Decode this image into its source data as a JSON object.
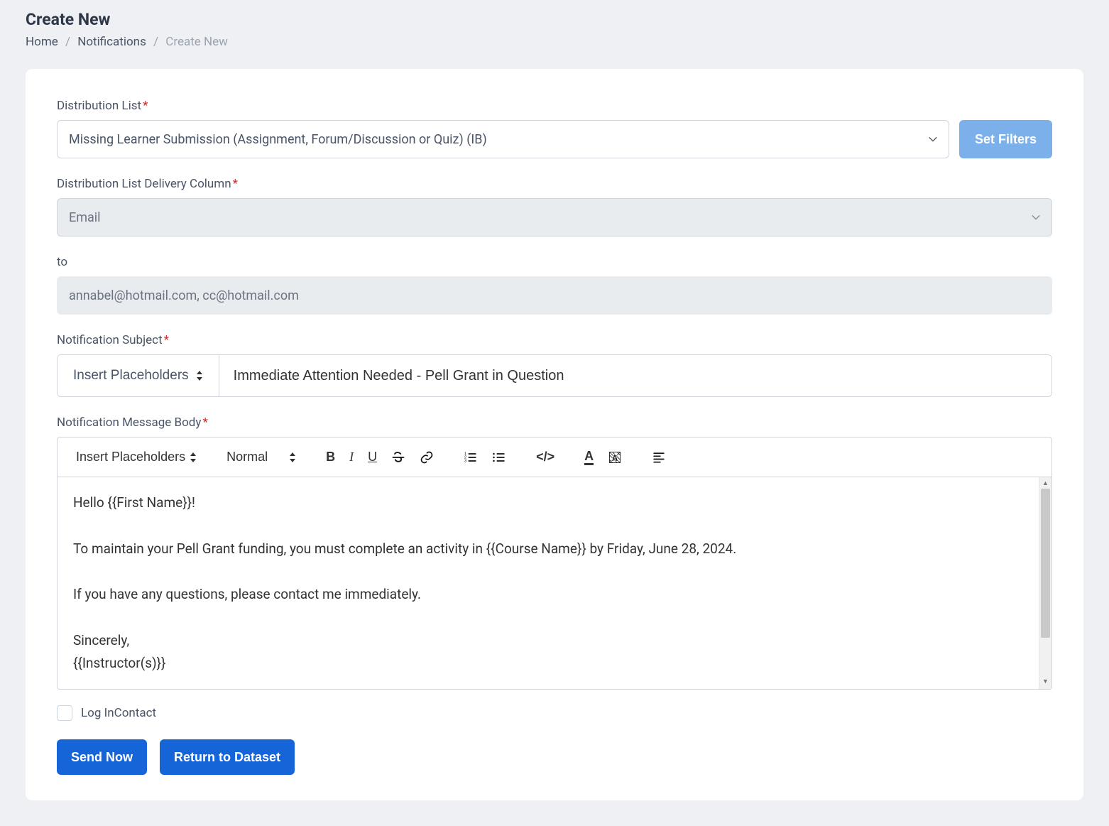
{
  "header": {
    "title": "Create New",
    "breadcrumb": {
      "home": "Home",
      "notifications": "Notifications",
      "current": "Create New"
    }
  },
  "form": {
    "distribution_list": {
      "label": "Distribution List",
      "value": "Missing Learner Submission (Assignment, Forum/Discussion or Quiz) (IB)",
      "set_filters": "Set Filters"
    },
    "delivery_column": {
      "label": "Distribution List Delivery Column",
      "value": "Email"
    },
    "to": {
      "label": "to",
      "value": "annabel@hotmail.com, cc@hotmail.com"
    },
    "subject": {
      "label": "Notification Subject",
      "placeholder_btn": "Insert Placeholders",
      "value": "Immediate Attention Needed - Pell Grant in Question"
    },
    "body": {
      "label": "Notification Message Body",
      "toolbar": {
        "placeholders": "Insert Placeholders",
        "format": "Normal"
      },
      "content": {
        "l1": "Hello {{First Name}}!",
        "l2": "To maintain your Pell Grant funding, you must complete an activity in {{Course Name}} by Friday, June 28, 2024.",
        "l3": "If you have any questions, please contact me immediately.",
        "l4": "Sincerely,",
        "l5": "{{Instructor(s)}}"
      }
    },
    "log_incontact": {
      "label": "Log InContact",
      "checked": false
    },
    "actions": {
      "send": "Send Now",
      "return": "Return to Dataset"
    }
  }
}
